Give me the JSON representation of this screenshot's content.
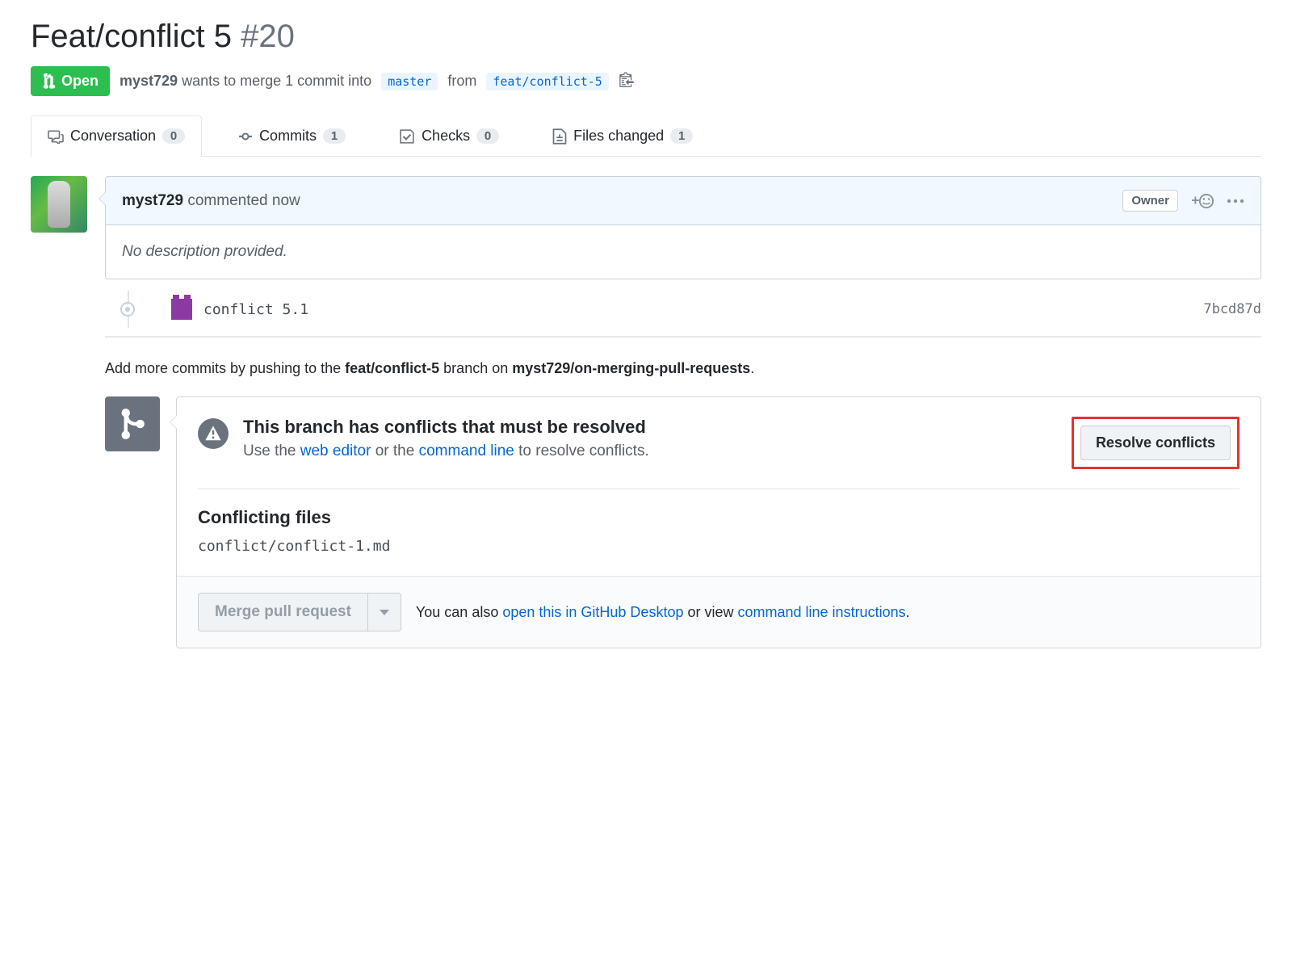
{
  "pr": {
    "title": "Feat/conflict 5",
    "number": "#20",
    "state": "Open",
    "author": "myst729",
    "merge_text_1": "wants to merge 1 commit into",
    "base_branch": "master",
    "merge_text_2": "from",
    "head_branch": "feat/conflict-5"
  },
  "tabs": {
    "conversation": {
      "label": "Conversation",
      "count": "0"
    },
    "commits": {
      "label": "Commits",
      "count": "1"
    },
    "checks": {
      "label": "Checks",
      "count": "0"
    },
    "files": {
      "label": "Files changed",
      "count": "1"
    }
  },
  "comment": {
    "author": "myst729",
    "action": " commented now",
    "owner_label": "Owner",
    "body": "No description provided."
  },
  "commit": {
    "message": "conflict 5.1",
    "sha": "7bcd87d"
  },
  "push_hint": {
    "prefix": "Add more commits by pushing to the ",
    "branch": "feat/conflict-5",
    "mid": " branch on ",
    "repo": "myst729/on-merging-pull-requests",
    "suffix": "."
  },
  "conflict": {
    "title": "This branch has conflicts that must be resolved",
    "hint_prefix": "Use the ",
    "web_editor": "web editor",
    "hint_mid": " or the ",
    "command_line": "command line",
    "hint_suffix": " to resolve conflicts.",
    "resolve_btn": "Resolve conflicts",
    "files_title": "Conflicting files",
    "file": "conflict/conflict-1.md"
  },
  "merge": {
    "button": "Merge pull request",
    "hint_prefix": "You can also ",
    "desktop_link": "open this in GitHub Desktop",
    "hint_mid": " or view ",
    "cli_link": "command line instructions",
    "hint_suffix": "."
  }
}
